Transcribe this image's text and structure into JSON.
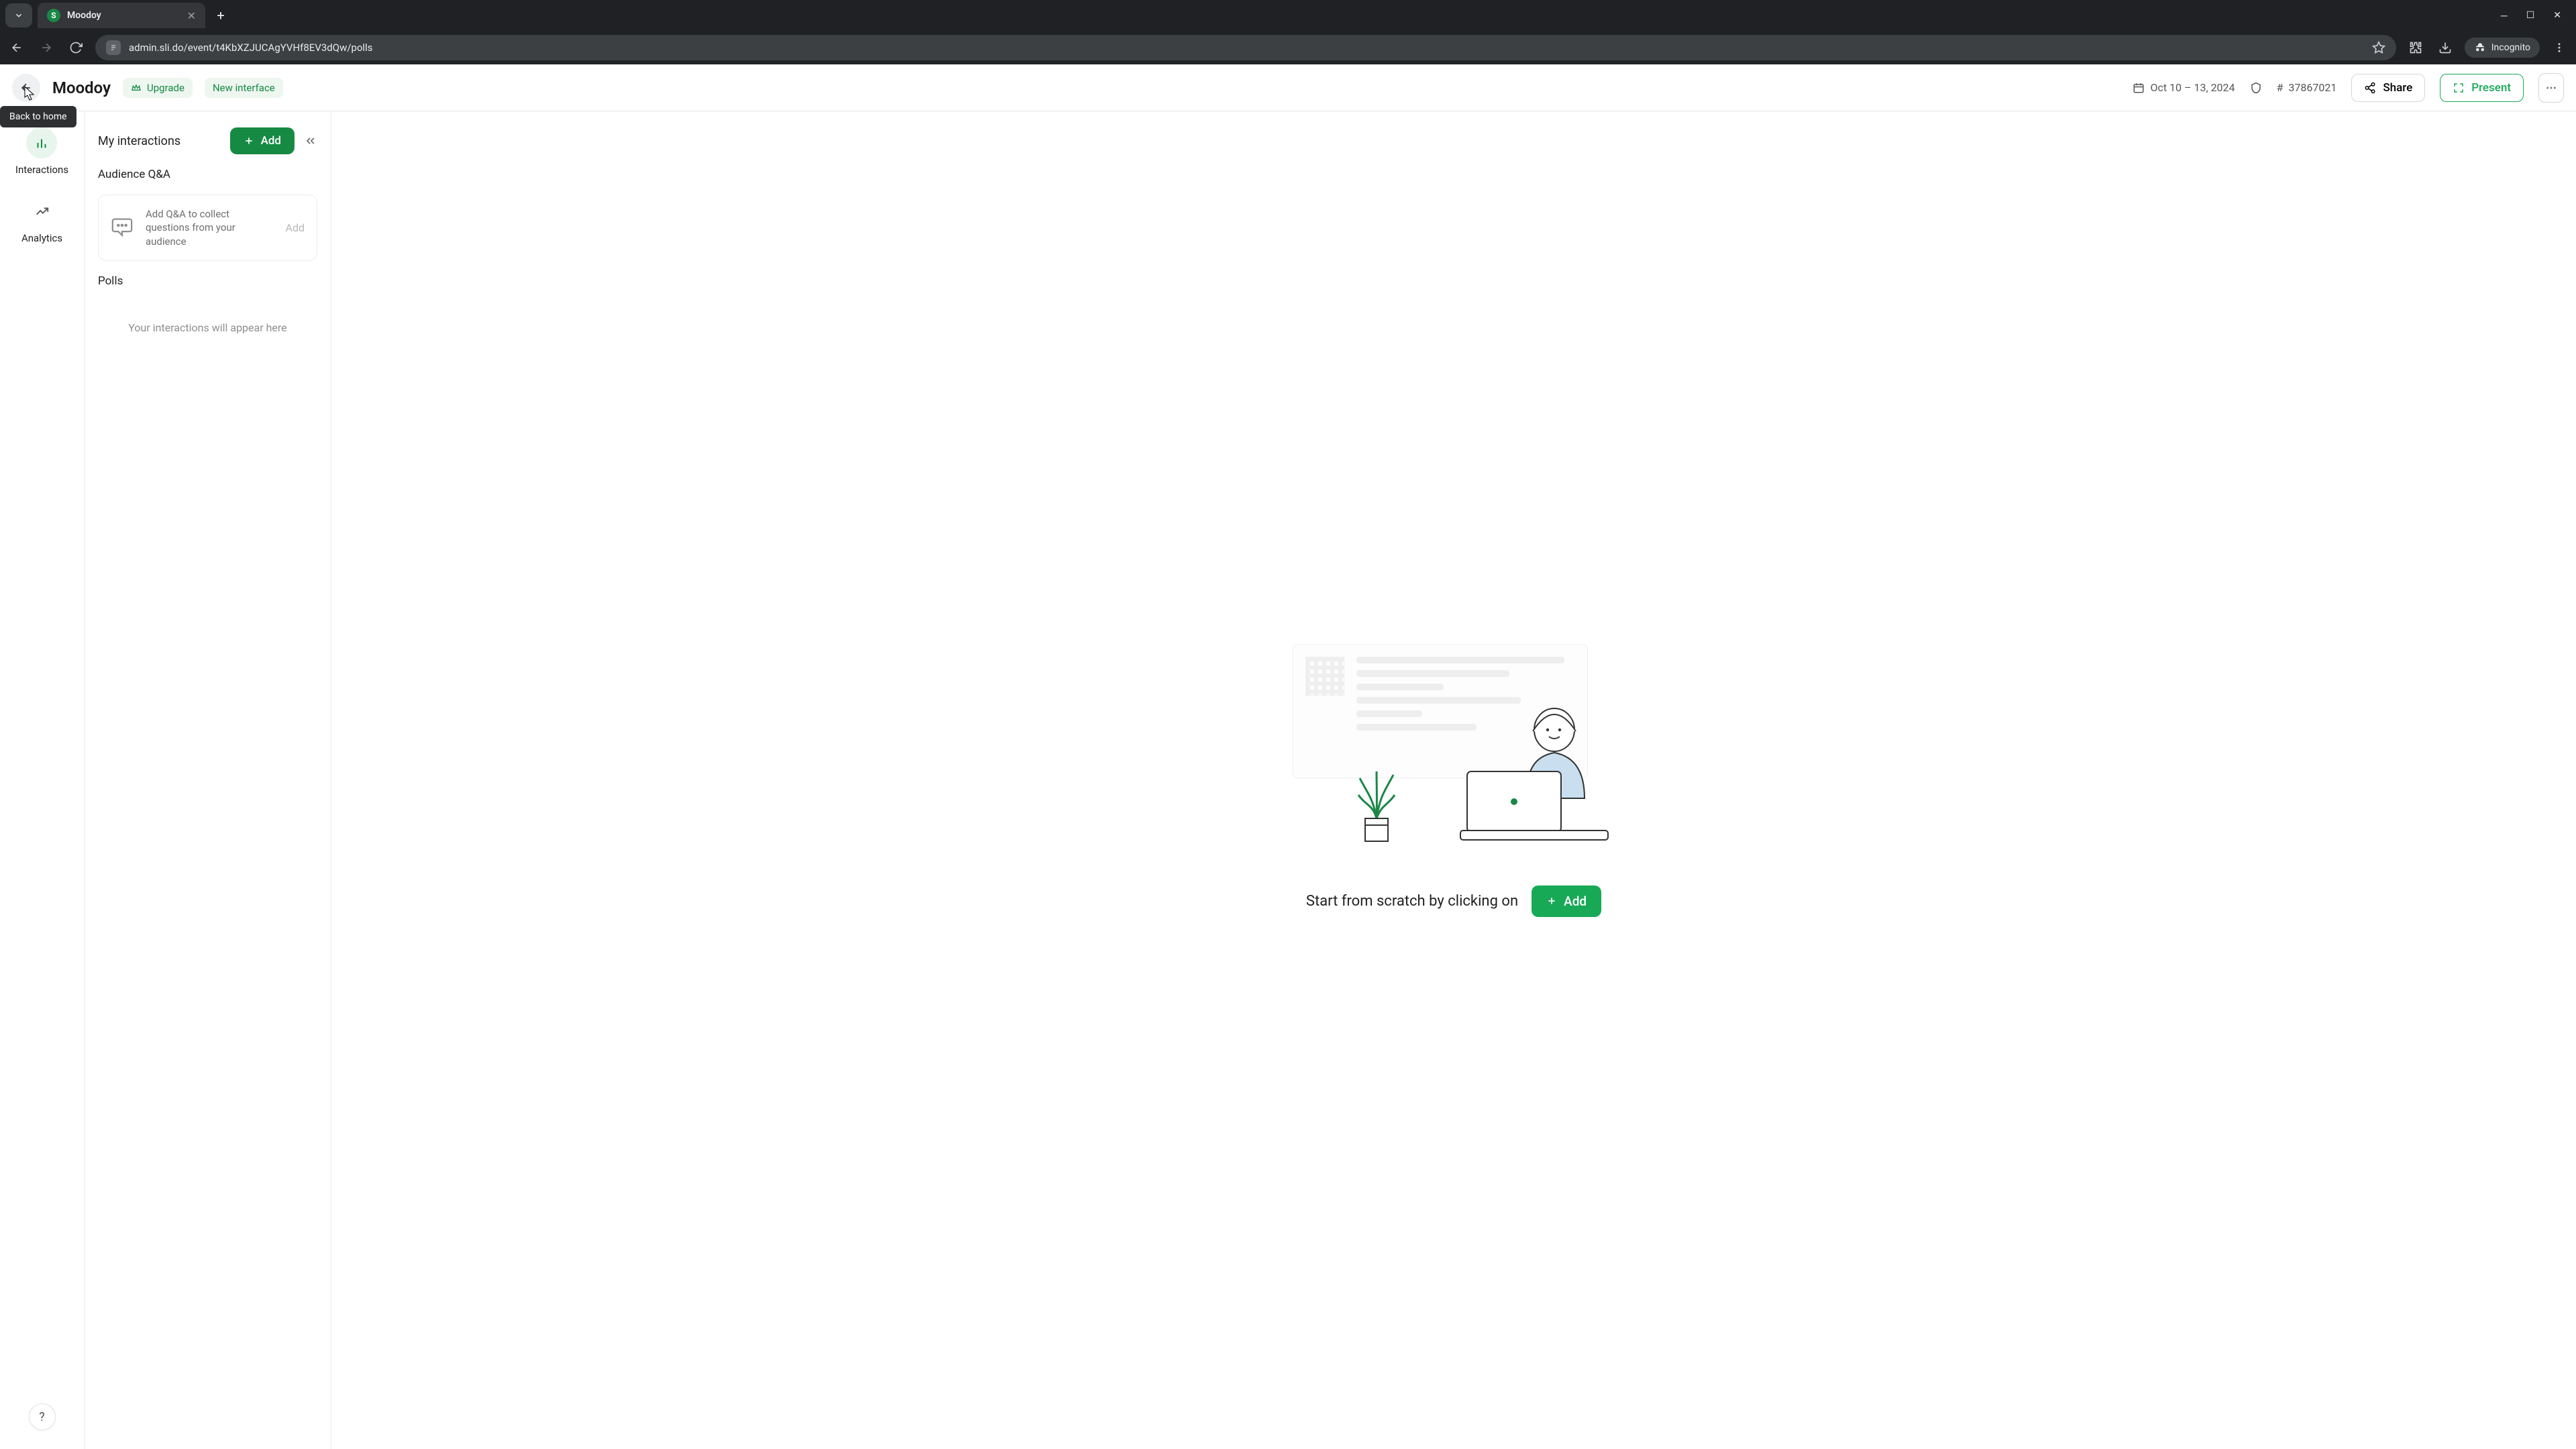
{
  "browser": {
    "tab_title": "Moodoy",
    "url": "admin.sli.do/event/t4KbXZJUCAgYVHf8EV3dQw/polls",
    "incognito_label": "Incognito"
  },
  "header": {
    "back_tooltip": "Back to home",
    "title": "Moodoy",
    "upgrade_label": "Upgrade",
    "new_interface_label": "New interface",
    "date_range": "Oct 10 – 13, 2024",
    "event_code": "37867021",
    "share_label": "Share",
    "present_label": "Present"
  },
  "rail": {
    "interactions_label": "Interactions",
    "analytics_label": "Analytics"
  },
  "panel": {
    "title": "My interactions",
    "add_label": "Add",
    "qa_heading": "Audience Q&A",
    "qa_prompt": "Add Q&A to collect questions from your audience",
    "qa_add_label": "Add",
    "polls_heading": "Polls",
    "polls_empty": "Your interactions will appear here"
  },
  "canvas": {
    "start_text": "Start from scratch by clicking on",
    "add_label": "Add"
  }
}
